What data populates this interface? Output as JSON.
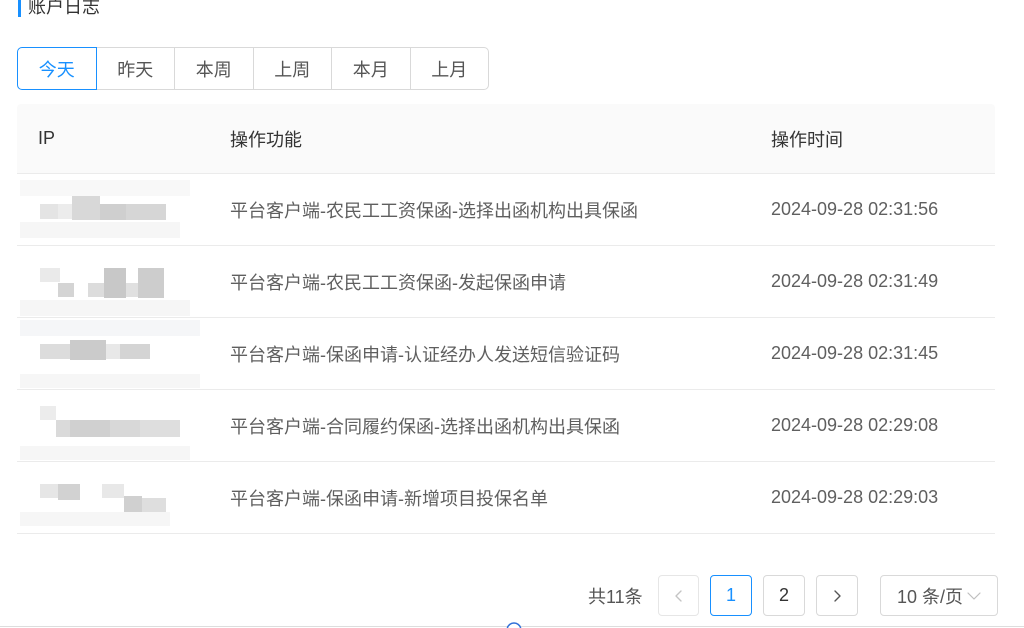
{
  "page": {
    "title": "账户日志"
  },
  "filters": {
    "options": [
      {
        "label": "今天",
        "selected": true
      },
      {
        "label": "昨天",
        "selected": false
      },
      {
        "label": "本周",
        "selected": false
      },
      {
        "label": "上周",
        "selected": false
      },
      {
        "label": "本月",
        "selected": false
      },
      {
        "label": "上月",
        "selected": false
      }
    ]
  },
  "table": {
    "columns": {
      "ip": "IP",
      "function": "操作功能",
      "time": "操作时间"
    },
    "rows": [
      {
        "function": "平台客户端-农民工工资保函-选择出函机构出具保函",
        "time": "2024-09-28 02:31:56"
      },
      {
        "function": "平台客户端-农民工工资保函-发起保函申请",
        "time": "2024-09-28 02:31:49"
      },
      {
        "function": "平台客户端-保函申请-认证经办人发送短信验证码",
        "time": "2024-09-28 02:31:45"
      },
      {
        "function": "平台客户端-合同履约保函-选择出函机构出具保函",
        "time": "2024-09-28 02:29:08"
      },
      {
        "function": "平台客户端-保函申请-新增项目投保名单",
        "time": "2024-09-28 02:29:03"
      }
    ]
  },
  "pagination": {
    "total_label": "共11条",
    "prev_disabled": true,
    "pages": [
      {
        "label": "1",
        "current": true
      },
      {
        "label": "2",
        "current": false
      }
    ],
    "page_size_label": "10 条/页",
    "icons": {
      "prev": "chevron-left-icon",
      "next": "chevron-right-icon",
      "page_size": "chevron-down-icon",
      "bottom": "circle-icon"
    }
  },
  "theme": {
    "accent": "#1890ff",
    "header_bg": "#fafafa",
    "header_text": "#333333",
    "cell_text": "#5f5f5f",
    "border": "#d9d9d9",
    "divider": "#ebebeb",
    "page_bg": "#ffffff"
  }
}
